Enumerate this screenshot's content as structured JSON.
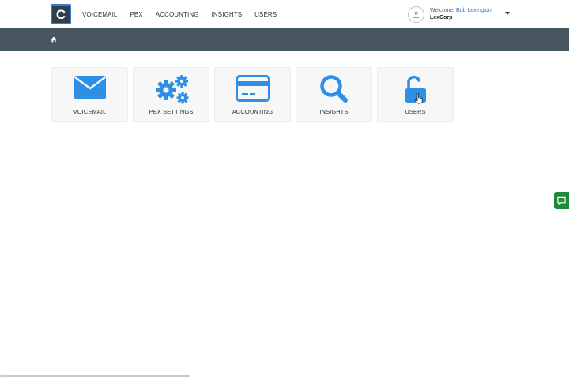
{
  "brand": {
    "logo_letter": "C",
    "accent": "#2f3f4d"
  },
  "nav": {
    "items": [
      {
        "label": "VOICEMAIL"
      },
      {
        "label": "PBX"
      },
      {
        "label": "ACCOUNTING"
      },
      {
        "label": "INSIGHTS"
      },
      {
        "label": "USERS"
      }
    ]
  },
  "user": {
    "welcome": "Welcome, ",
    "name": "Bob Lexington",
    "org": "LexCorp",
    "avatar_icon": "user-icon",
    "menu_icon": "caret-down-icon"
  },
  "breadcrumb": {
    "home_icon": "home-icon",
    "bar_color": "#48565f"
  },
  "tiles": [
    {
      "label": "VOICEMAIL",
      "icon": "envelope-icon"
    },
    {
      "label": "PBX SETTINGS",
      "icon": "gears-icon"
    },
    {
      "label": "ACCOUNTING",
      "icon": "credit-card-icon"
    },
    {
      "label": "INSIGHTS",
      "icon": "magnifier-icon"
    },
    {
      "label": "USERS",
      "icon": "unlock-icon"
    }
  ],
  "icon_color": "#2f8fe6",
  "feedback": {
    "icon": "chat-icon",
    "color": "#1d8a3a"
  }
}
